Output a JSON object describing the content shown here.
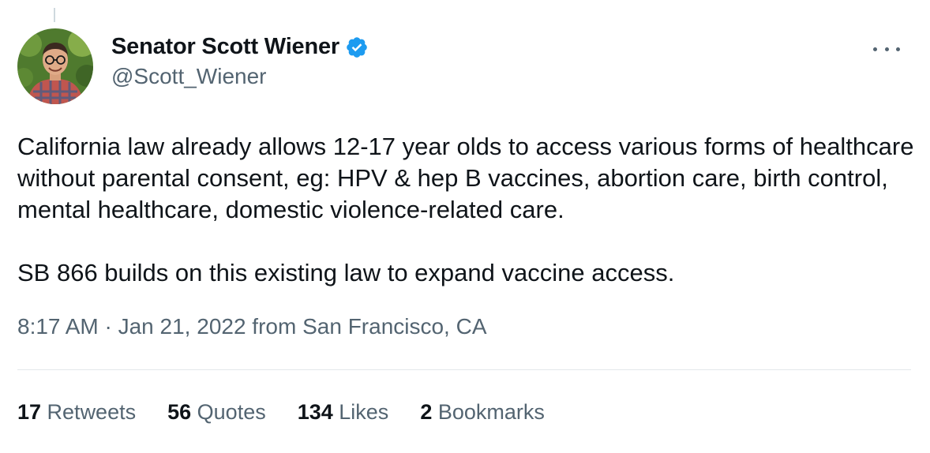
{
  "author": {
    "display_name": "Senator Scott Wiener",
    "handle": "@Scott_Wiener",
    "verified": true,
    "verified_color": "#1d9bf0"
  },
  "tweet": {
    "paragraphs": [
      "California law already allows 12-17 year olds to access various forms of healthcare without parental consent, eg: HPV & hep B vaccines, abortion care, birth control, mental healthcare, domestic violence-related care.",
      "SB 866 builds on this existing law to expand vaccine access."
    ],
    "timestamp": "8:17 AM · Jan 21, 2022 from San Francisco, CA"
  },
  "stats": [
    {
      "count": "17",
      "label": "Retweets"
    },
    {
      "count": "56",
      "label": "Quotes"
    },
    {
      "count": "134",
      "label": "Likes"
    },
    {
      "count": "2",
      "label": "Bookmarks"
    }
  ],
  "icons": {
    "verified": "verified-badge-icon",
    "more": "more-options-icon"
  }
}
